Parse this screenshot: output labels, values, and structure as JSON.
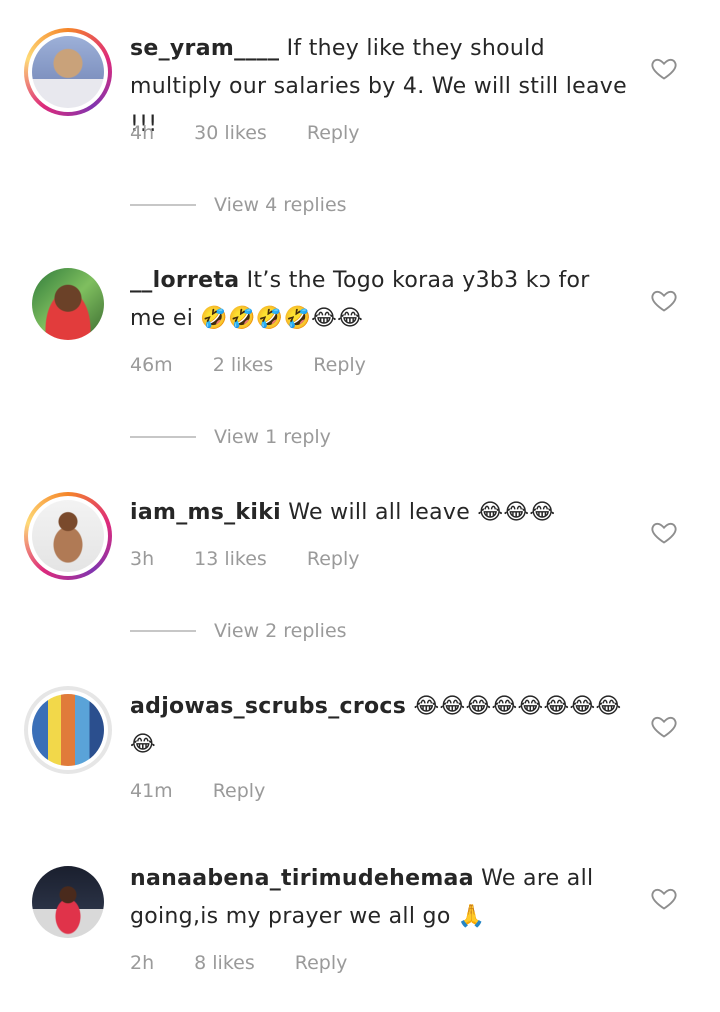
{
  "comments": [
    {
      "username": "se_yram____",
      "text": "If they like they should multiply our salaries by 4. We will still leave !!!",
      "time": "4h",
      "likes": "30 likes",
      "reply_label": "Reply",
      "view_replies": "View 4 replies"
    },
    {
      "username": "__lorreta",
      "text": "It’s the Togo koraa y3b3 kↄ for me ei 🤣🤣🤣🤣😂😂",
      "time": "46m",
      "likes": "2 likes",
      "reply_label": "Reply",
      "view_replies": "View 1 reply"
    },
    {
      "username": "iam_ms_kiki",
      "text": "We will all leave 😂😂😂",
      "time": "3h",
      "likes": "13 likes",
      "reply_label": "Reply",
      "view_replies": "View 2 replies"
    },
    {
      "username": "adjowas_scrubs_crocs",
      "text": "😂😂😂😂😂😂😂😂😂",
      "time": "41m",
      "reply_label": "Reply"
    },
    {
      "username": "nanaabena_tirimudehemaa",
      "text": "We are all going,is my prayer we all  go 🙏",
      "time": "2h",
      "likes": "8 likes",
      "reply_label": "Reply"
    }
  ],
  "colors": {
    "text": "#262626",
    "muted": "#9a9a9a",
    "story_ring_start": "#f58529",
    "story_ring_end": "#dd2a7b"
  },
  "icons": {
    "like": "heart-outline-icon"
  }
}
